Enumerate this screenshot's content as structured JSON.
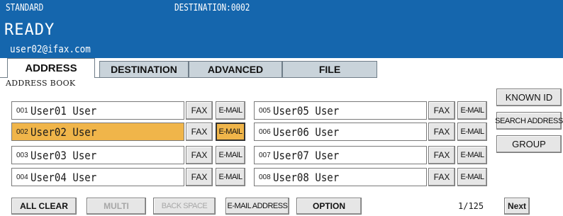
{
  "header": {
    "mode": "STANDARD",
    "destination": "DESTINATION:0002",
    "status": "READY",
    "sender": "user02@ifax.com"
  },
  "tabs": [
    {
      "label": "ADDRESS",
      "active": true
    },
    {
      "label": "DESTINATION",
      "active": false
    },
    {
      "label": "ADVANCED",
      "active": false
    },
    {
      "label": "FILE",
      "active": false
    }
  ],
  "section_label": "ADDRESS BOOK",
  "entries": [
    {
      "number": "001",
      "name": "User01 User",
      "fax": "FAX",
      "email": "E-MAIL",
      "selected": false,
      "email_selected": false
    },
    {
      "number": "002",
      "name": "User02 User",
      "fax": "FAX",
      "email": "E-MAIL",
      "selected": true,
      "email_selected": true
    },
    {
      "number": "003",
      "name": "User03 User",
      "fax": "FAX",
      "email": "E-MAIL",
      "selected": false,
      "email_selected": false
    },
    {
      "number": "004",
      "name": "User04 User",
      "fax": "FAX",
      "email": "E-MAIL",
      "selected": false,
      "email_selected": false
    },
    {
      "number": "005",
      "name": "User05 User",
      "fax": "FAX",
      "email": "E-MAIL",
      "selected": false,
      "email_selected": false
    },
    {
      "number": "006",
      "name": "User06 User",
      "fax": "FAX",
      "email": "E-MAIL",
      "selected": false,
      "email_selected": false
    },
    {
      "number": "007",
      "name": "User07 User",
      "fax": "FAX",
      "email": "E-MAIL",
      "selected": false,
      "email_selected": false
    },
    {
      "number": "008",
      "name": "User08 User",
      "fax": "FAX",
      "email": "E-MAIL",
      "selected": false,
      "email_selected": false
    }
  ],
  "side_buttons": {
    "known_id": "KNOWN ID",
    "search_address": "SEARCH ADDRESS",
    "group": "GROUP"
  },
  "bottom": {
    "all_clear": "ALL CLEAR",
    "multi": "MULTI",
    "back_space": "BACK SPACE",
    "email_address": "E-MAIL ADDRESS",
    "option": "OPTION",
    "page": "1/125",
    "next": "Next"
  },
  "colors": {
    "header_bg": "#1566ad",
    "selected_bg": "#f0b54a",
    "button_bg": "#e6e6e6",
    "disabled_text": "#a7a7a7"
  }
}
